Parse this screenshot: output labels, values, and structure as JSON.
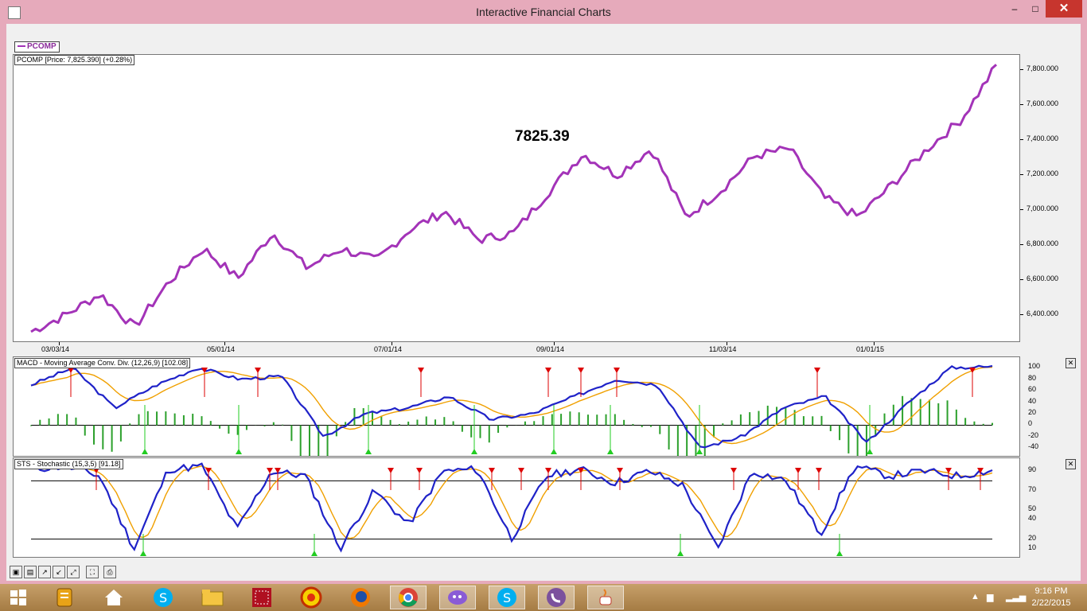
{
  "window": {
    "title": "Interactive Financial Charts",
    "min": "–",
    "max": "□",
    "close": "✕"
  },
  "price": {
    "legend": "PCOMP",
    "header": "PCOMP [Price: 7,825.390] (+0.28%)",
    "big_label": "7825.39",
    "color": "#a333b8",
    "y_ticks": [
      "7,800.000",
      "7,600.000",
      "7,400.000",
      "7,200.000",
      "7,000.000",
      "6,800.000",
      "6,600.000",
      "6,400.000"
    ],
    "x_ticks": [
      "03/03/14",
      "05/01/14",
      "07/01/14",
      "09/01/14",
      "11/03/14",
      "01/01/15"
    ]
  },
  "macd": {
    "header": "MACD - Moving Average Conv. Div. (12,26,9) [102.08]",
    "y_ticks": [
      "100",
      "80",
      "60",
      "40",
      "20",
      "0",
      "-20",
      "-40"
    ],
    "close": "✕"
  },
  "sto": {
    "header": "STS - Stochastic (15,3,5) [91.18]",
    "y_ticks": [
      "90",
      "70",
      "50",
      "40",
      "20",
      "10"
    ],
    "close": "✕"
  },
  "toolbar": {
    "icons": [
      "open-icon",
      "save-icon",
      "zoom-in-icon",
      "zoom-out-icon",
      "zoom-fit-icon",
      "fullscreen-icon",
      "print-icon"
    ]
  },
  "taskbar": {
    "apps": [
      "windows-icon",
      "notes-icon",
      "home-icon",
      "skype-icon",
      "file-explorer-icon",
      "calculator-icon",
      "paint-icon",
      "firefox-icon",
      "chrome-icon",
      "yahoo-messenger-icon",
      "skype-icon",
      "viber-icon",
      "java-icon"
    ],
    "time": "9:16 PM",
    "date": "2/22/2015"
  },
  "chart_data": [
    {
      "type": "line",
      "title": "PCOMP [Price: 7,825.390] (+0.28%)",
      "series": [
        {
          "name": "PCOMP",
          "x": [
            "2014-02-24",
            "2014-03-07",
            "2014-03-21",
            "2014-04-04",
            "2014-04-11",
            "2014-04-25",
            "2014-05-01",
            "2014-05-16",
            "2014-06-06",
            "2014-06-20",
            "2014-07-03",
            "2014-07-18",
            "2014-08-01",
            "2014-08-15",
            "2014-09-01",
            "2014-09-19",
            "2014-10-03",
            "2014-10-10",
            "2014-10-17",
            "2014-11-03",
            "2014-11-28",
            "2014-12-05",
            "2014-12-19",
            "2015-01-01",
            "2015-01-09",
            "2015-01-16",
            "2015-01-30",
            "2015-02-13",
            "2015-02-20"
          ],
          "values": [
            6305,
            6400,
            6520,
            6330,
            6590,
            6780,
            6610,
            6870,
            6670,
            6780,
            6710,
            6890,
            6990,
            6830,
            6870,
            7100,
            7320,
            7200,
            7350,
            6960,
            7110,
            7310,
            7350,
            7070,
            6960,
            7150,
            7350,
            7520,
            7825
          ]
        }
      ],
      "ylim": [
        6250,
        7850
      ]
    },
    {
      "type": "line",
      "title": "MACD - Moving Average Conv. Div. (12,26,9) [102.08]",
      "series": [
        {
          "name": "MACD",
          "values": [
            70,
            100,
            30,
            70,
            100,
            80,
            85,
            -20,
            20,
            30,
            50,
            10,
            20,
            50,
            80,
            70,
            -40,
            -20,
            30,
            50,
            -30,
            40,
            100,
            102
          ]
        }
      ],
      "ylim": [
        -45,
        110
      ]
    },
    {
      "type": "line",
      "title": "STS - Stochastic (15,3,5) [91.18]",
      "series": [
        {
          "name": "Stochastic",
          "values": [
            92,
            95,
            85,
            10,
            92,
            95,
            30,
            90,
            85,
            10,
            70,
            35,
            90,
            92,
            20,
            85,
            92,
            78,
            90,
            75,
            10,
            90,
            80,
            25,
            95,
            85,
            90,
            85,
            91
          ]
        }
      ],
      "ylim": [
        5,
        100
      ]
    }
  ]
}
